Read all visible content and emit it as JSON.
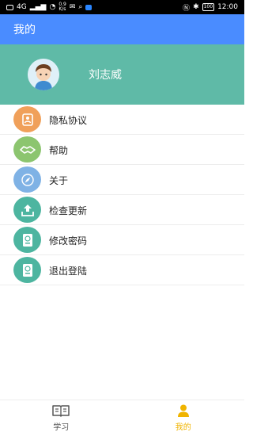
{
  "status_bar": {
    "network": "4G",
    "speed_value": "0.9",
    "speed_unit": "K/s",
    "battery": "100",
    "time": "12:00"
  },
  "header": {
    "title": "我的"
  },
  "profile": {
    "name": "刘志威"
  },
  "menu": {
    "items": [
      {
        "label": "隐私协议",
        "icon": "document-icon",
        "color": "#f0a05a"
      },
      {
        "label": "帮助",
        "icon": "handshake-icon",
        "color": "#8cc56f"
      },
      {
        "label": "关于",
        "icon": "compass-icon",
        "color": "#7fb2e5"
      },
      {
        "label": "检查更新",
        "icon": "upload-icon",
        "color": "#4db5a0"
      },
      {
        "label": "修改密码",
        "icon": "passport-icon",
        "color": "#4db5a0"
      },
      {
        "label": "退出登陆",
        "icon": "passport-icon",
        "color": "#4db5a0"
      }
    ]
  },
  "tabs": [
    {
      "label": "学习",
      "icon": "book-icon",
      "active": false
    },
    {
      "label": "我的",
      "icon": "person-icon",
      "active": true
    }
  ],
  "colors": {
    "header": "#4a8cff",
    "profile": "#5fbaa7",
    "active_tab": "#f0b400"
  }
}
